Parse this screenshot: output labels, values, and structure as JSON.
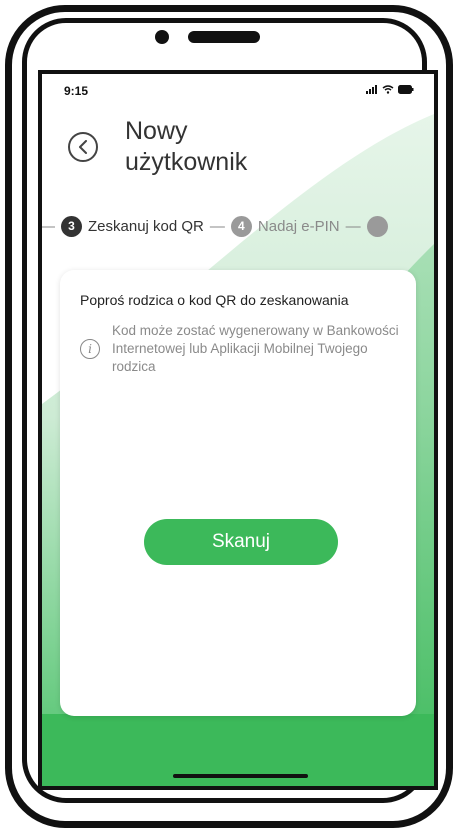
{
  "status_bar": {
    "time": "9:15"
  },
  "header": {
    "back_icon": "chevron-left-icon",
    "title_line1": "Nowy",
    "title_line2": "użytkownik"
  },
  "steps": {
    "active": {
      "number": "3",
      "label": "Zeskanuj kod QR"
    },
    "next": {
      "number": "4",
      "label": "Nadaj e-PIN"
    }
  },
  "card": {
    "heading": "Poproś rodzica o kod QR do zeskanowania",
    "info_icon": "info-icon",
    "info_text": "Kod może zostać wygenerowany w Bankowości Internetowej lub Aplikacji Mobilnej Twojego rodzica"
  },
  "scan_button": {
    "label": "Skanuj"
  },
  "colors": {
    "accent": "#3cb95a",
    "background_green": "#4cc26a"
  }
}
